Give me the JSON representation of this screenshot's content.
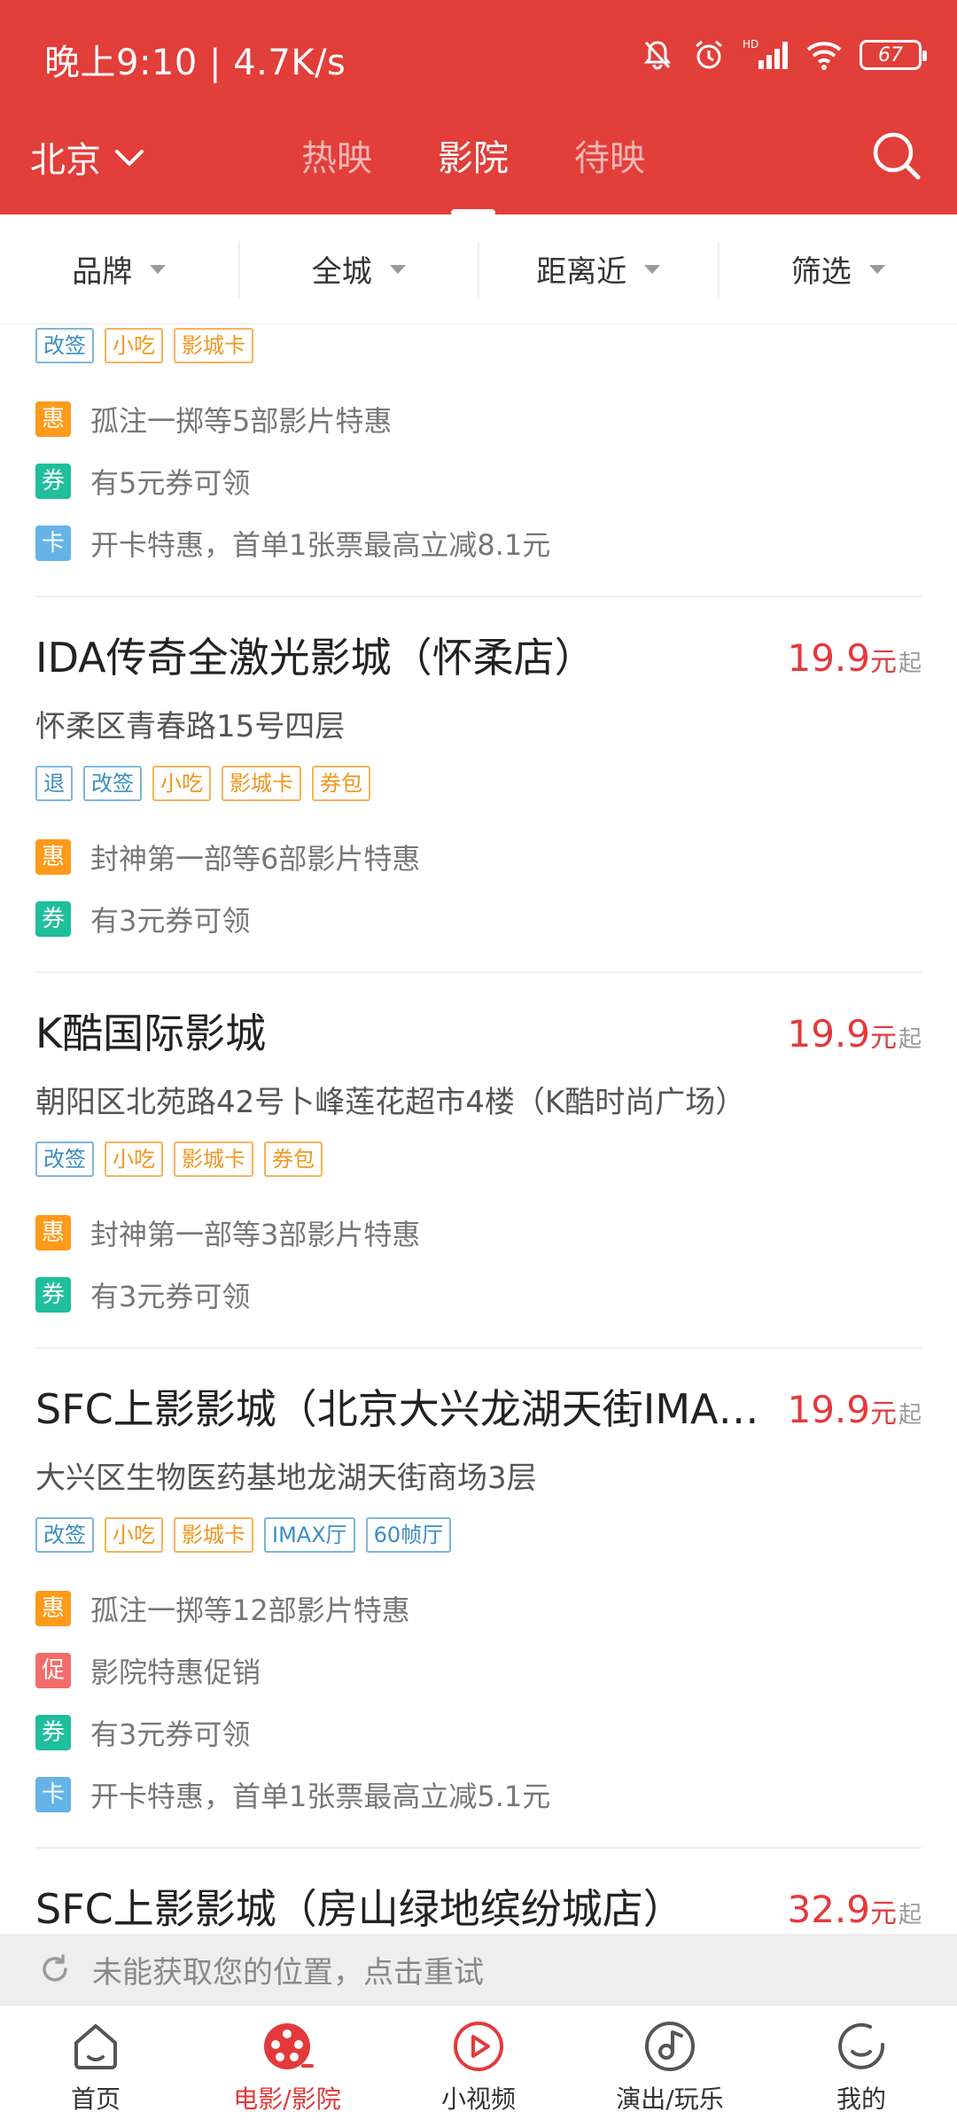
{
  "status_bar": {
    "time_speed": "晚上9:10 | 4.7K/s",
    "battery": "67",
    "network": "HD"
  },
  "header": {
    "city": "北京",
    "tabs": [
      {
        "label": "热映",
        "active": false
      },
      {
        "label": "影院",
        "active": true
      },
      {
        "label": "待映",
        "active": false
      }
    ]
  },
  "filters": [
    {
      "label": "品牌"
    },
    {
      "label": "全城"
    },
    {
      "label": "距离近"
    },
    {
      "label": "筛选"
    }
  ],
  "cinemas": [
    {
      "name": "",
      "address": "",
      "price": "",
      "tags": [
        {
          "text": "改签",
          "color": "blue"
        },
        {
          "text": "小吃",
          "color": "orange"
        },
        {
          "text": "影城卡",
          "color": "orange"
        }
      ],
      "promos": [
        {
          "badge": "惠",
          "type": "hui",
          "text": "孤注一掷等5部影片特惠"
        },
        {
          "badge": "券",
          "type": "quan",
          "text": "有5元券可领"
        },
        {
          "badge": "卡",
          "type": "ka",
          "text": "开卡特惠，首单1张票最高立减8.1元"
        }
      ]
    },
    {
      "name": "IDA传奇全激光影城（怀柔店）",
      "address": "怀柔区青春路15号四层",
      "price": "19.9",
      "tags": [
        {
          "text": "退",
          "color": "blue"
        },
        {
          "text": "改签",
          "color": "blue"
        },
        {
          "text": "小吃",
          "color": "orange"
        },
        {
          "text": "影城卡",
          "color": "orange"
        },
        {
          "text": "券包",
          "color": "orange"
        }
      ],
      "promos": [
        {
          "badge": "惠",
          "type": "hui",
          "text": "封神第一部等6部影片特惠"
        },
        {
          "badge": "券",
          "type": "quan",
          "text": "有3元券可领"
        }
      ]
    },
    {
      "name": "K酷国际影城",
      "address": "朝阳区北苑路42号卜峰莲花超市4楼（K酷时尚广场）",
      "price": "19.9",
      "tags": [
        {
          "text": "改签",
          "color": "blue"
        },
        {
          "text": "小吃",
          "color": "orange"
        },
        {
          "text": "影城卡",
          "color": "orange"
        },
        {
          "text": "券包",
          "color": "orange"
        }
      ],
      "promos": [
        {
          "badge": "惠",
          "type": "hui",
          "text": "封神第一部等3部影片特惠"
        },
        {
          "badge": "券",
          "type": "quan",
          "text": "有3元券可领"
        }
      ]
    },
    {
      "name": "SFC上影影城（北京大兴龙湖天街IMAX店）",
      "address": "大兴区生物医药基地龙湖天街商场3层",
      "price": "19.9",
      "tags": [
        {
          "text": "改签",
          "color": "blue"
        },
        {
          "text": "小吃",
          "color": "orange"
        },
        {
          "text": "影城卡",
          "color": "orange"
        },
        {
          "text": "IMAX厅",
          "color": "blue"
        },
        {
          "text": "60帧厅",
          "color": "blue"
        }
      ],
      "promos": [
        {
          "badge": "惠",
          "type": "hui",
          "text": "孤注一掷等12部影片特惠"
        },
        {
          "badge": "促",
          "type": "cu",
          "text": "影院特惠促销"
        },
        {
          "badge": "券",
          "type": "quan",
          "text": "有3元券可领"
        },
        {
          "badge": "卡",
          "type": "ka",
          "text": "开卡特惠，首单1张票最高立减5.1元"
        }
      ]
    },
    {
      "name": "SFC上影影城（房山绿地缤纷城店）",
      "address": "",
      "price": "32.9",
      "tags": [],
      "promos": []
    }
  ],
  "price_unit": "元",
  "price_suffix": "起",
  "location_bar": {
    "text": "未能获取您的位置，点击重试"
  },
  "bottom_nav": [
    {
      "label": "首页",
      "icon": "home-icon",
      "active": false
    },
    {
      "label": "电影/影院",
      "icon": "film-reel-icon",
      "active": true
    },
    {
      "label": "小视频",
      "icon": "play-circle-icon",
      "active": false
    },
    {
      "label": "演出/玩乐",
      "icon": "music-disc-icon",
      "active": false
    },
    {
      "label": "我的",
      "icon": "profile-circle-icon",
      "active": false
    }
  ],
  "colors": {
    "brand_red": "#e23e3a",
    "price_red": "#e4393c",
    "tag_blue": "#3a8ec2",
    "tag_orange": "#f0961c",
    "badge_hui": "#ff9a1a",
    "badge_quan": "#1fbf9c",
    "badge_ka": "#66b3ea",
    "badge_cu": "#f36b6b"
  }
}
